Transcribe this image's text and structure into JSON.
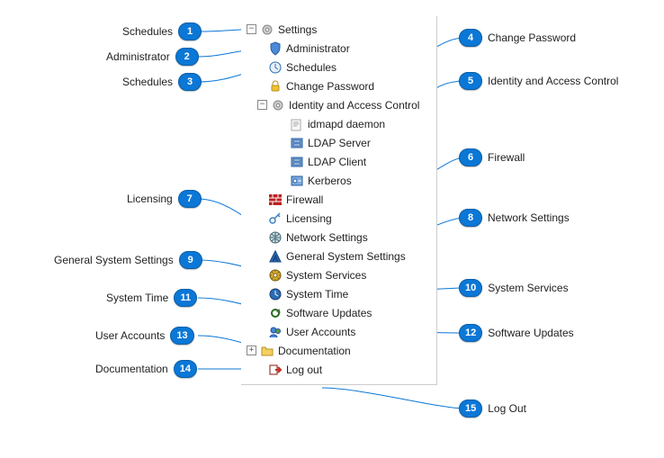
{
  "tree": {
    "root": {
      "label": "Settings",
      "expanded": true
    },
    "items": {
      "administrator": "Administrator",
      "schedules": "Schedules",
      "changePassword": "Change Password",
      "iac": {
        "label": "Identity and Access Control",
        "expanded": true,
        "children": {
          "idmapd": "idmapd daemon",
          "ldapServer": "LDAP Server",
          "ldapClient": "LDAP Client",
          "kerberos": "Kerberos"
        }
      },
      "firewall": "Firewall",
      "licensing": "Licensing",
      "network": "Network Settings",
      "general": "General System Settings",
      "services": "System Services",
      "time": "System Time",
      "updates": "Software Updates",
      "users": "User Accounts",
      "docs": {
        "label": "Documentation",
        "expanded": false
      },
      "logout": "Log out"
    }
  },
  "callouts": {
    "1": "Schedules",
    "2": "Administrator",
    "3": "Schedules",
    "4": "Change Password",
    "5": "Identity and Access Control",
    "6": "Firewall",
    "7": "Licensing",
    "8": "Network Settings",
    "9": "General System Settings",
    "10": "System Services",
    "11": "System Time",
    "12": "Software Updates",
    "13": "User Accounts",
    "14": "Documentation",
    "15": "Log Out"
  },
  "nums": {
    "1": "1",
    "2": "2",
    "3": "3",
    "4": "4",
    "5": "5",
    "6": "6",
    "7": "7",
    "8": "8",
    "9": "9",
    "10": "10",
    "11": "11",
    "12": "12",
    "13": "13",
    "14": "14",
    "15": "15"
  }
}
